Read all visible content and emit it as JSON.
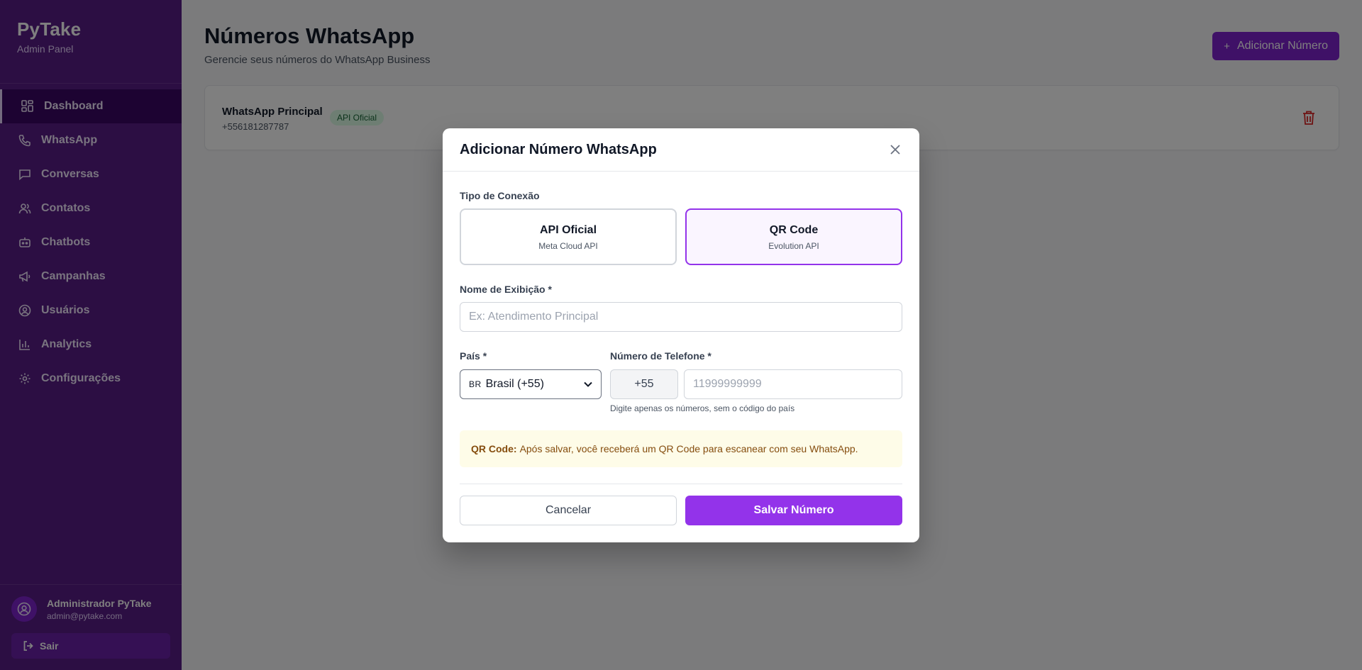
{
  "brand": {
    "title": "PyTake",
    "subtitle": "Admin Panel"
  },
  "sidebar": {
    "items": [
      {
        "label": "Dashboard",
        "icon": "dashboard-icon",
        "active": true
      },
      {
        "label": "WhatsApp",
        "icon": "phone-icon"
      },
      {
        "label": "Conversas",
        "icon": "chat-icon"
      },
      {
        "label": "Contatos",
        "icon": "users-icon"
      },
      {
        "label": "Chatbots",
        "icon": "bot-icon"
      },
      {
        "label": "Campanhas",
        "icon": "megaphone-icon"
      },
      {
        "label": "Usuários",
        "icon": "user-circle-icon"
      },
      {
        "label": "Analytics",
        "icon": "bar-chart-icon"
      },
      {
        "label": "Configurações",
        "icon": "gear-icon"
      }
    ],
    "user": {
      "name": "Administrador PyTake",
      "email": "admin@pytake.com"
    },
    "logout_label": "Sair"
  },
  "page": {
    "title": "Números WhatsApp",
    "subtitle": "Gerencie seus números do WhatsApp Business",
    "add_button": "Adicionar Número",
    "add_button_icon": "+"
  },
  "numbers": [
    {
      "name": "WhatsApp Principal",
      "phone": "+556181287787",
      "badge": "API Oficial"
    }
  ],
  "modal": {
    "title": "Adicionar Número WhatsApp",
    "connection_label": "Tipo de Conexão",
    "connection_options": [
      {
        "title": "API Oficial",
        "subtitle": "Meta Cloud API",
        "selected": false
      },
      {
        "title": "QR Code",
        "subtitle": "Evolution API",
        "selected": true
      }
    ],
    "display_name_label": "Nome de Exibição *",
    "display_name_placeholder": "Ex: Atendimento Principal",
    "country_label": "País *",
    "country_flag": "BR",
    "country_value": "Brasil (+55)",
    "phone_label": "Número de Telefone *",
    "phone_prefix": "+55",
    "phone_placeholder": "11999999999",
    "phone_hint": "Digite apenas os números, sem o código do país",
    "info_bold": "QR Code:",
    "info_text": "Após salvar, você receberá um QR Code para escanear com seu WhatsApp.",
    "cancel_label": "Cancelar",
    "save_label": "Salvar Número"
  },
  "colors": {
    "sidebar_bg": "#581c87",
    "accent": "#9333ea",
    "badge_bg": "#dcfce7",
    "info_bg": "#fefce8",
    "danger": "#dc2626"
  }
}
